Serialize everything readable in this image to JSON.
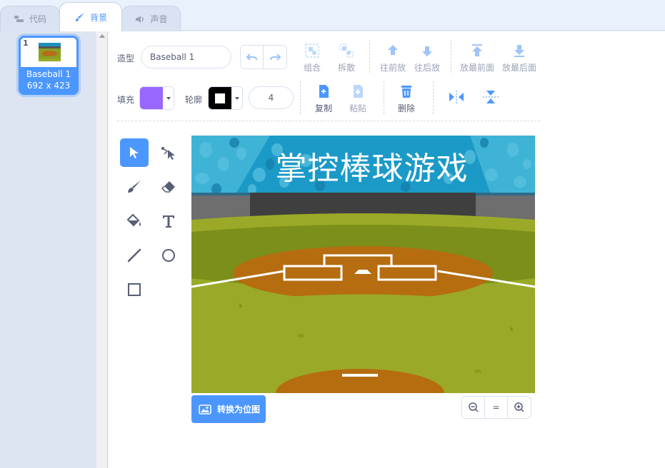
{
  "tabs": [
    {
      "label": "代码",
      "icon": "code-icon"
    },
    {
      "label": "背景",
      "icon": "brush-icon"
    },
    {
      "label": "声音",
      "icon": "speaker-icon"
    }
  ],
  "costume": {
    "number": "1",
    "name": "Baseball 1",
    "size": "692 x 423"
  },
  "toolbar": {
    "costume_label": "造型",
    "costume_name": "Baseball 1",
    "group": "组合",
    "ungroup": "拆散",
    "forward": "往前放",
    "backward": "往后放",
    "front": "放最前面",
    "back": "放最后面",
    "fill_label": "填充",
    "fill_color": "#9966ff",
    "outline_label": "轮廓",
    "outline_color": "#000000",
    "outline_width": "4",
    "copy": "复制",
    "paste": "粘贴",
    "delete": "删除"
  },
  "canvas": {
    "title": "掌控棒球游戏"
  },
  "convert_label": "转换为位图",
  "zoom": {
    "reset": "="
  },
  "colors": {
    "accent": "#4c97ff",
    "text": "#575e75"
  }
}
